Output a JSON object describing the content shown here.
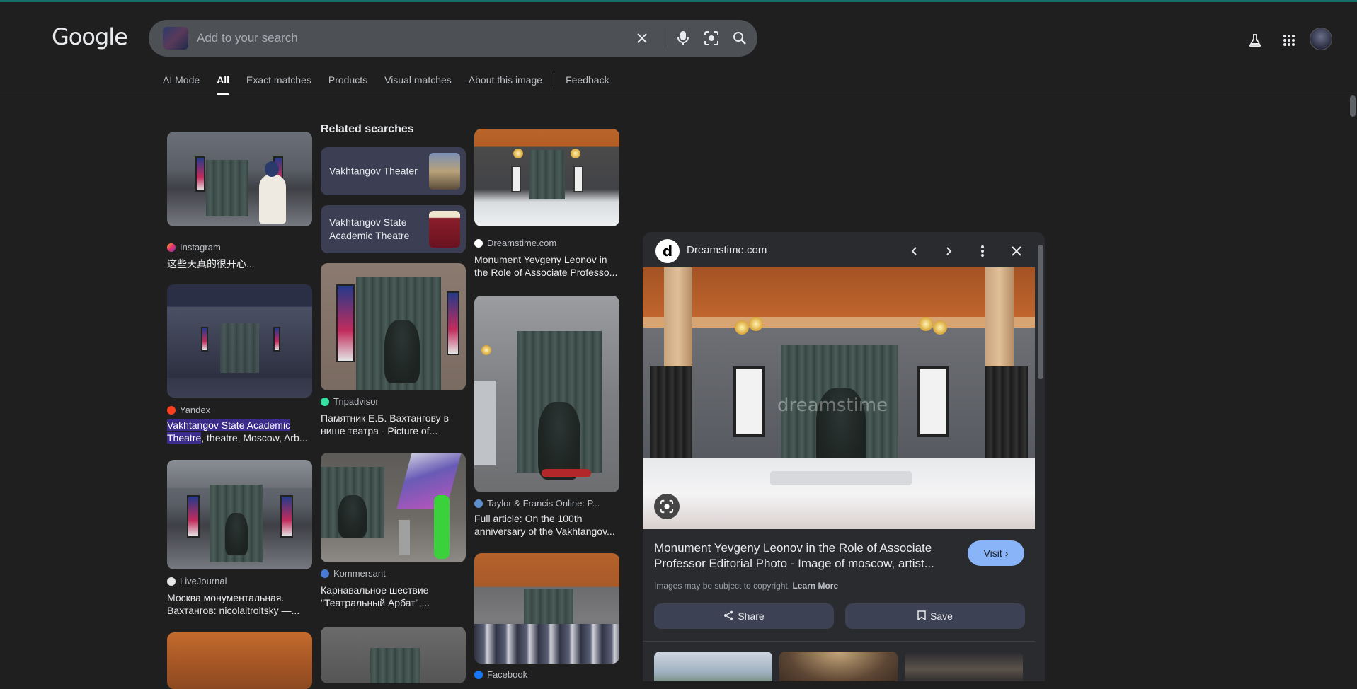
{
  "logo": "Google",
  "search": {
    "placeholder": "Add to your search"
  },
  "tabs": [
    "AI Mode",
    "All",
    "Exact matches",
    "Products",
    "Visual matches",
    "About this image",
    "Feedback"
  ],
  "related": {
    "title": "Related searches",
    "items": [
      "Vakhtangov Theater",
      "Vakhtangov State Academic Theatre"
    ]
  },
  "results": {
    "instagram": {
      "source": "Instagram",
      "title": "这些天真的很开心..."
    },
    "yandex": {
      "source": "Yandex",
      "title_hl": "Vakhtangov State Academic Theatre",
      "title_rest": ", theatre, Moscow, Arb..."
    },
    "livejournal": {
      "source": "LiveJournal",
      "title": "Москва монументальная. Вахтангов: nicolaitroitsky —..."
    },
    "tripadvisor": {
      "source": "Tripadvisor",
      "title": "Памятник Е.Б. Вахтангову в нише театра - Picture of..."
    },
    "kommersant": {
      "source": "Kommersant",
      "title": "Карнавальное шествие \"Театральный Арбат\",..."
    },
    "dreamstime": {
      "source": "Dreamstime.com",
      "title": "Monument Yevgeny Leonov in the Role of Associate Professo..."
    },
    "taylor": {
      "source": "Taylor & Francis Online: P...",
      "title": "Full article: On the 100th anniversary of the Vakhtangov..."
    },
    "facebook": {
      "source": "Facebook"
    }
  },
  "panel": {
    "site": "Dreamstime.com",
    "title": "Monument Yevgeny Leonov in the Role of Associate Professor Editorial Photo - Image of moscow, artist...",
    "visit": "Visit",
    "copyright": "Images may be subject to copyright.",
    "learn_more": "Learn More",
    "share": "Share",
    "save": "Save",
    "watermark": "dreamstime"
  },
  "colors": {
    "background": "#1f1f1f",
    "accent": "#8ab4f8",
    "chip": "#3c3f54",
    "highlight": "#3a2b8c"
  }
}
